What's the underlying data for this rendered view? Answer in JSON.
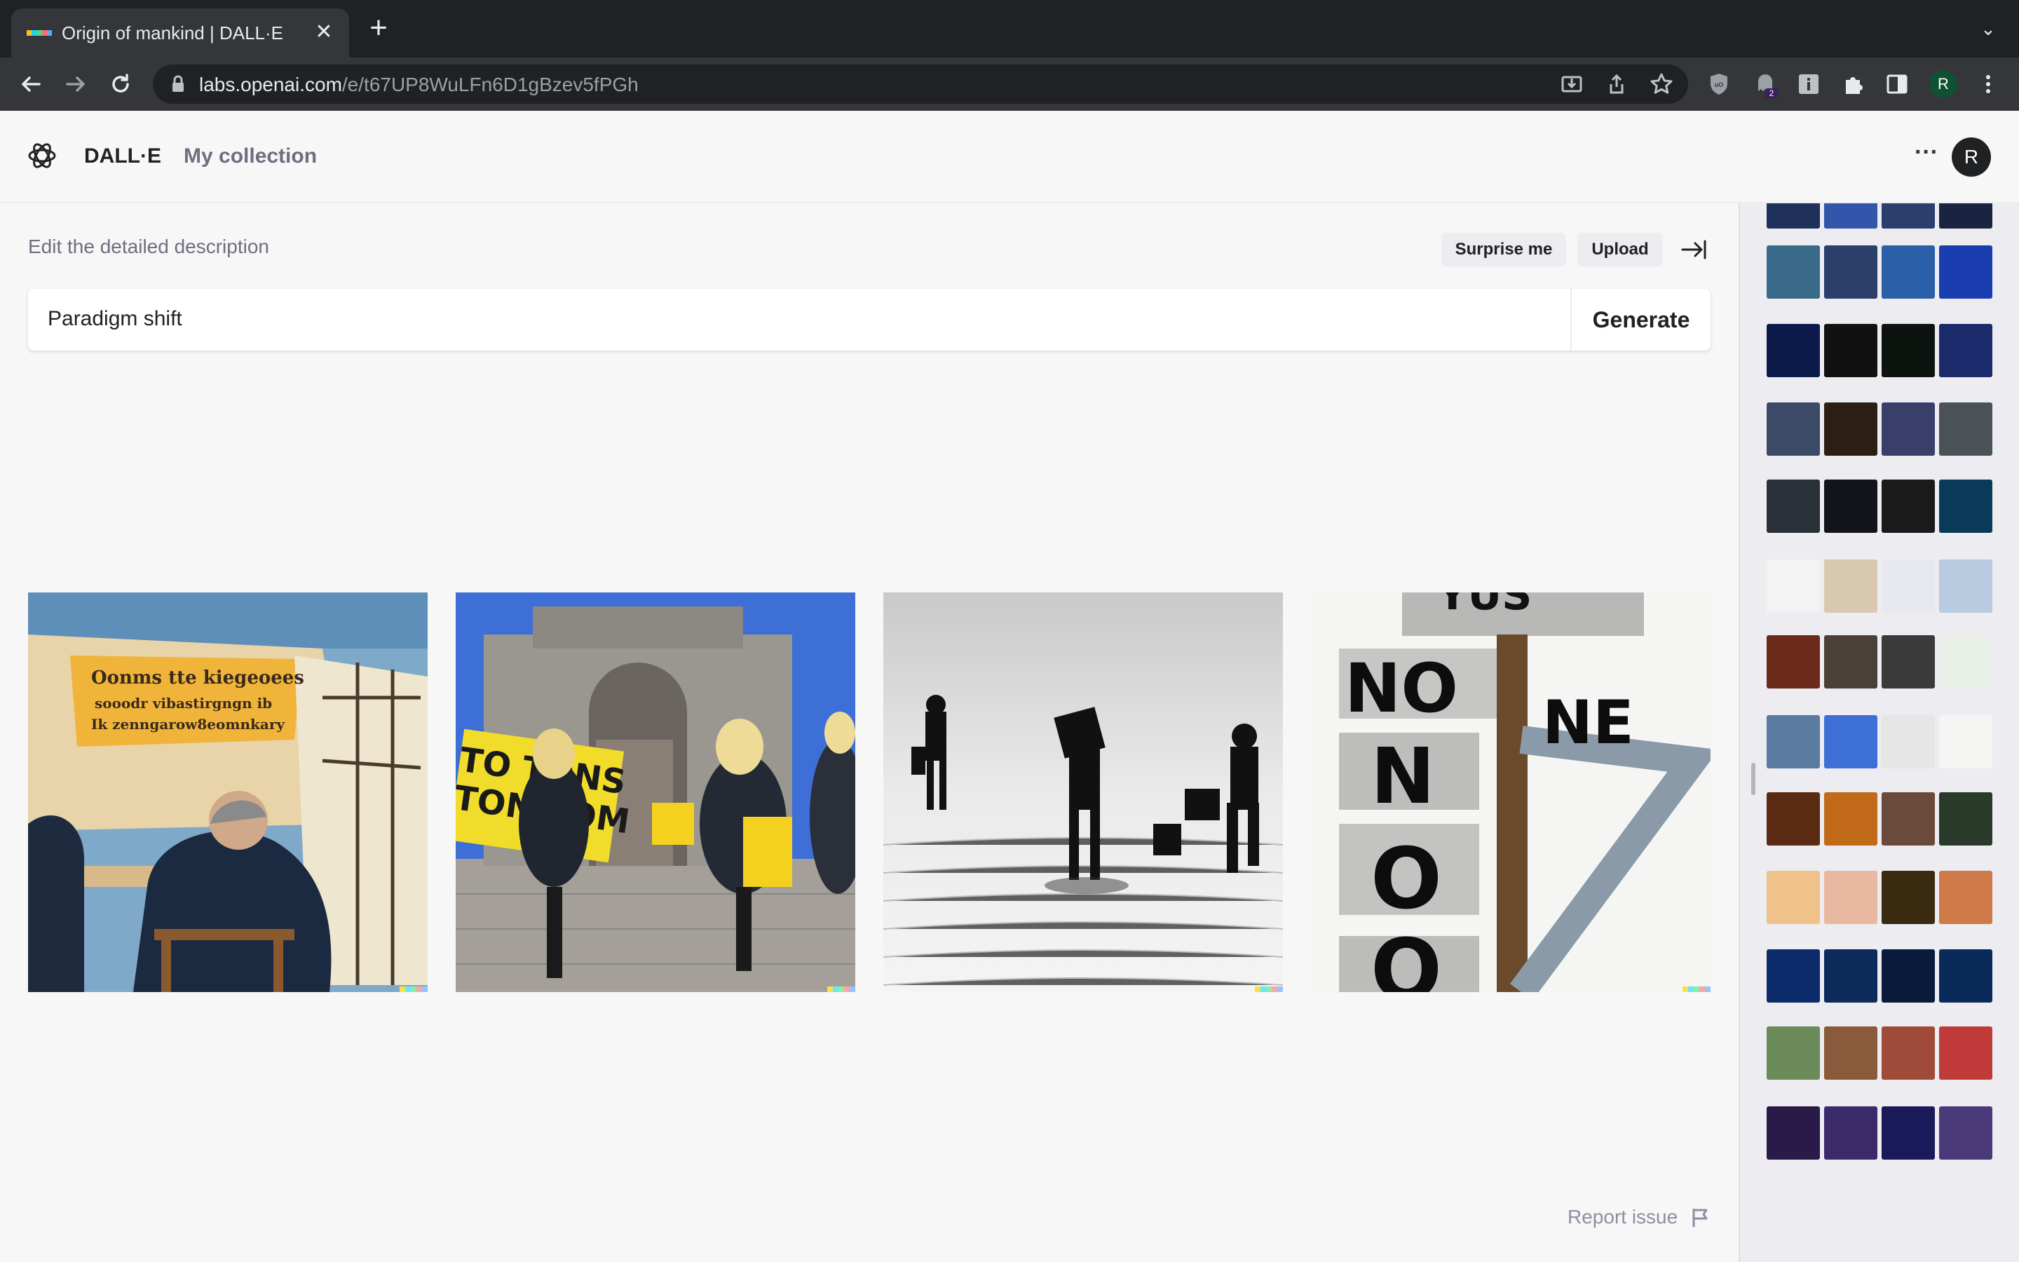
{
  "browser": {
    "tab_title": "Origin of mankind | DALL·E",
    "tab_close": "✕",
    "new_tab": "+",
    "tab_menu": "⌄",
    "url_host": "labs.openai.com",
    "url_path": "/e/t67UP8WuLFn6D1gBzev5fPGh",
    "profile_initial": "R",
    "extension_badge": "2"
  },
  "app": {
    "brand": "DALL·E",
    "my_collection": "My collection",
    "more": "···",
    "avatar_initial": "R"
  },
  "editor": {
    "description_label": "Edit the detailed description",
    "surprise_label": "Surprise me",
    "upload_label": "Upload",
    "prompt_value": "Paradigm shift",
    "generate_label": "Generate"
  },
  "results": [
    {
      "name": "result-image-1"
    },
    {
      "name": "result-image-2"
    },
    {
      "name": "result-image-3"
    },
    {
      "name": "result-image-4"
    }
  ],
  "footer": {
    "report_label": "Report issue"
  },
  "history": {
    "groups": 13
  },
  "colors": {
    "accent": "#202123",
    "background": "#f7f7f8",
    "muted_text": "#6e6e80"
  }
}
